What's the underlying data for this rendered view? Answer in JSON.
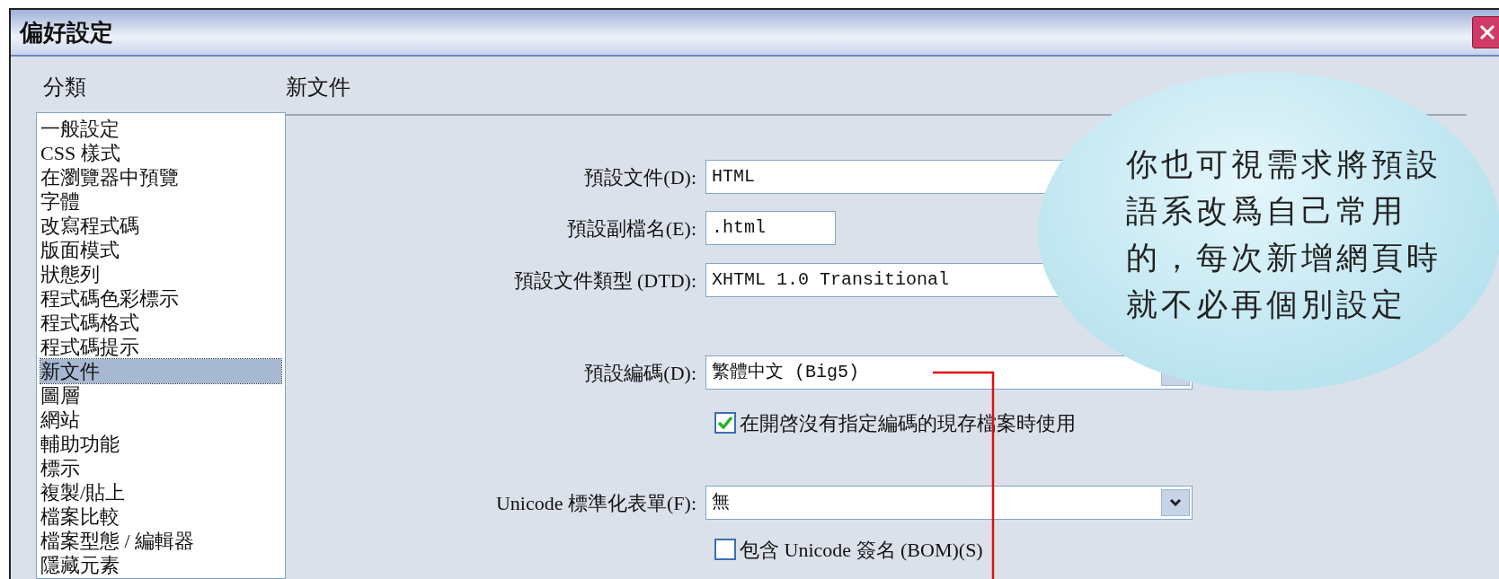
{
  "dialog": {
    "title": "偏好設定",
    "category_heading": "分類",
    "categories": [
      {
        "label": "一般設定",
        "selected": false
      },
      {
        "label": "CSS 樣式",
        "selected": false
      },
      {
        "label": "在瀏覽器中預覽",
        "selected": false
      },
      {
        "label": "字體",
        "selected": false
      },
      {
        "label": "改寫程式碼",
        "selected": false
      },
      {
        "label": "版面模式",
        "selected": false
      },
      {
        "label": "狀態列",
        "selected": false
      },
      {
        "label": "程式碼色彩標示",
        "selected": false
      },
      {
        "label": "程式碼格式",
        "selected": false
      },
      {
        "label": "程式碼提示",
        "selected": false
      },
      {
        "label": "新文件",
        "selected": true
      },
      {
        "label": "圖層",
        "selected": false
      },
      {
        "label": "網站",
        "selected": false
      },
      {
        "label": "輔助功能",
        "selected": false
      },
      {
        "label": "標示",
        "selected": false
      },
      {
        "label": "複製/貼上",
        "selected": false
      },
      {
        "label": "檔案比較",
        "selected": false
      },
      {
        "label": "檔案型態 / 編輯器",
        "selected": false
      },
      {
        "label": "隱藏元素",
        "selected": false
      }
    ],
    "section_title": "新文件",
    "fields": [
      {
        "kind": "text",
        "label": "預設文件(D):",
        "value": "HTML"
      },
      {
        "kind": "short",
        "label": "預設副檔名(E):",
        "value": ".html"
      },
      {
        "kind": "text",
        "label": "預設文件類型 (DTD):",
        "value": "XHTML 1.0 Transitional"
      },
      {
        "kind": "select",
        "label": "預設編碼(D):",
        "value": "繁體中文 (Big5)"
      },
      {
        "kind": "checkbox",
        "label": "在開啓沒有指定編碼的現存檔案時使用",
        "checked": true
      },
      {
        "kind": "select",
        "label": "Unicode 標準化表單(F):",
        "value": "無"
      },
      {
        "kind": "checkbox",
        "label": "包含 Unicode 簽名 (BOM)(S)",
        "checked": false
      }
    ]
  },
  "callout": {
    "lines": [
      "你也可視需求將預設",
      "語系改爲自己常用",
      "的，每次新增網頁時",
      "就不必再個別設定"
    ]
  }
}
